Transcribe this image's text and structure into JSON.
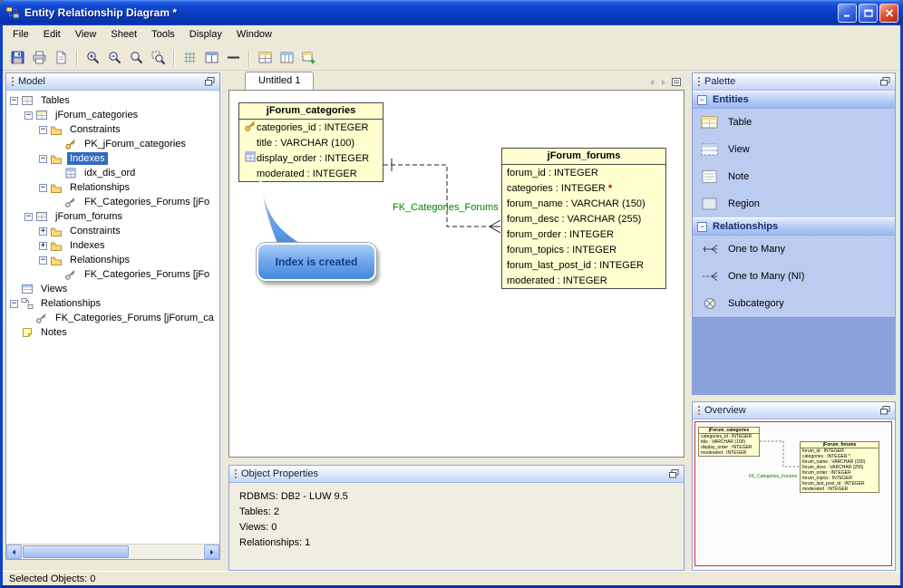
{
  "window": {
    "title": "Entity Relationship Diagram *",
    "status": "Selected Objects: 0"
  },
  "menubar": [
    "File",
    "Edit",
    "View",
    "Sheet",
    "Tools",
    "Display",
    "Window"
  ],
  "toolbar": {
    "groups": [
      [
        "save",
        "print",
        "print-preview"
      ],
      [
        "zoom-in",
        "zoom-out",
        "zoom-original",
        "zoom-selection"
      ],
      [
        "grid",
        "tile-horizontal",
        "straight-line"
      ],
      [
        "table-grid",
        "table-columns",
        "table-new"
      ]
    ]
  },
  "model_panel": {
    "title": "Model",
    "tree": [
      {
        "indent": 0,
        "expander": "-",
        "icon": "table",
        "label": "Tables"
      },
      {
        "indent": 1,
        "expander": "-",
        "icon": "table",
        "label": "jForum_categories"
      },
      {
        "indent": 2,
        "expander": "-",
        "icon": "folder",
        "label": "Constraints"
      },
      {
        "indent": 3,
        "expander": null,
        "icon": "key",
        "label": "PK_jForum_categories"
      },
      {
        "indent": 2,
        "expander": "-",
        "icon": "folder",
        "label": "Indexes",
        "selected": true
      },
      {
        "indent": 3,
        "expander": null,
        "icon": "index",
        "label": "idx_dis_ord"
      },
      {
        "indent": 2,
        "expander": "-",
        "icon": "folder",
        "label": "Relationships"
      },
      {
        "indent": 3,
        "expander": null,
        "icon": "fk",
        "label": "FK_Categories_Forums [jFo"
      },
      {
        "indent": 1,
        "expander": "-",
        "icon": "table",
        "label": "jForum_forums"
      },
      {
        "indent": 2,
        "expander": "+",
        "icon": "folder",
        "label": "Constraints"
      },
      {
        "indent": 2,
        "expander": "+",
        "icon": "folder",
        "label": "Indexes"
      },
      {
        "indent": 2,
        "expander": "-",
        "icon": "folder",
        "label": "Relationships"
      },
      {
        "indent": 3,
        "expander": null,
        "icon": "fk",
        "label": "FK_Categories_Forums [jFo"
      },
      {
        "indent": 0,
        "expander": null,
        "icon": "views",
        "label": "Views"
      },
      {
        "indent": 0,
        "expander": "-",
        "icon": "relationships",
        "label": "Relationships"
      },
      {
        "indent": 1,
        "expander": null,
        "icon": "fk",
        "label": "FK_Categories_Forums [jForum_ca"
      },
      {
        "indent": 0,
        "expander": null,
        "icon": "notes",
        "label": "Notes"
      }
    ]
  },
  "sheet": {
    "tab": "Untitled 1",
    "relationship_label": "FK_Categories_Forums",
    "callout": "Index is created",
    "tables": [
      {
        "name": "jForum_categories",
        "fields": [
          {
            "icon": "key",
            "text": "categories_id : INTEGER"
          },
          {
            "icon": null,
            "text": "title : VARCHAR (100)"
          },
          {
            "icon": "index",
            "text": "display_order : INTEGER"
          },
          {
            "icon": null,
            "text": "moderated : INTEGER"
          }
        ]
      },
      {
        "name": "jForum_forums",
        "fields": [
          {
            "icon": null,
            "text": "forum_id : INTEGER"
          },
          {
            "icon": null,
            "text": "categories : INTEGER",
            "mark": "*"
          },
          {
            "icon": null,
            "text": "forum_name : VARCHAR (150)"
          },
          {
            "icon": null,
            "text": "forum_desc : VARCHAR (255)"
          },
          {
            "icon": null,
            "text": "forum_order : INTEGER"
          },
          {
            "icon": null,
            "text": "forum_topics : INTEGER"
          },
          {
            "icon": null,
            "text": "forum_last_post_id : INTEGER"
          },
          {
            "icon": null,
            "text": "moderated : INTEGER"
          }
        ]
      }
    ]
  },
  "object_properties": {
    "title": "Object Properties",
    "lines": [
      "RDBMS: DB2 - LUW 9.5",
      "Tables: 2",
      "Views: 0",
      "Relationships: 1"
    ]
  },
  "palette": {
    "title": "Palette",
    "sections": [
      {
        "label": "Entities",
        "items": [
          {
            "icon": "palette-table",
            "label": "Table"
          },
          {
            "icon": "palette-view",
            "label": "View"
          },
          {
            "icon": "palette-note",
            "label": "Note"
          },
          {
            "icon": "palette-region",
            "label": "Region"
          }
        ]
      },
      {
        "label": "Relationships",
        "items": [
          {
            "icon": "one-to-many",
            "label": "One to Many"
          },
          {
            "icon": "one-to-many-ni",
            "label": "One to Many (NI)"
          },
          {
            "icon": "subcategory",
            "label": "Subcategory"
          }
        ]
      }
    ]
  },
  "overview": {
    "title": "Overview"
  }
}
